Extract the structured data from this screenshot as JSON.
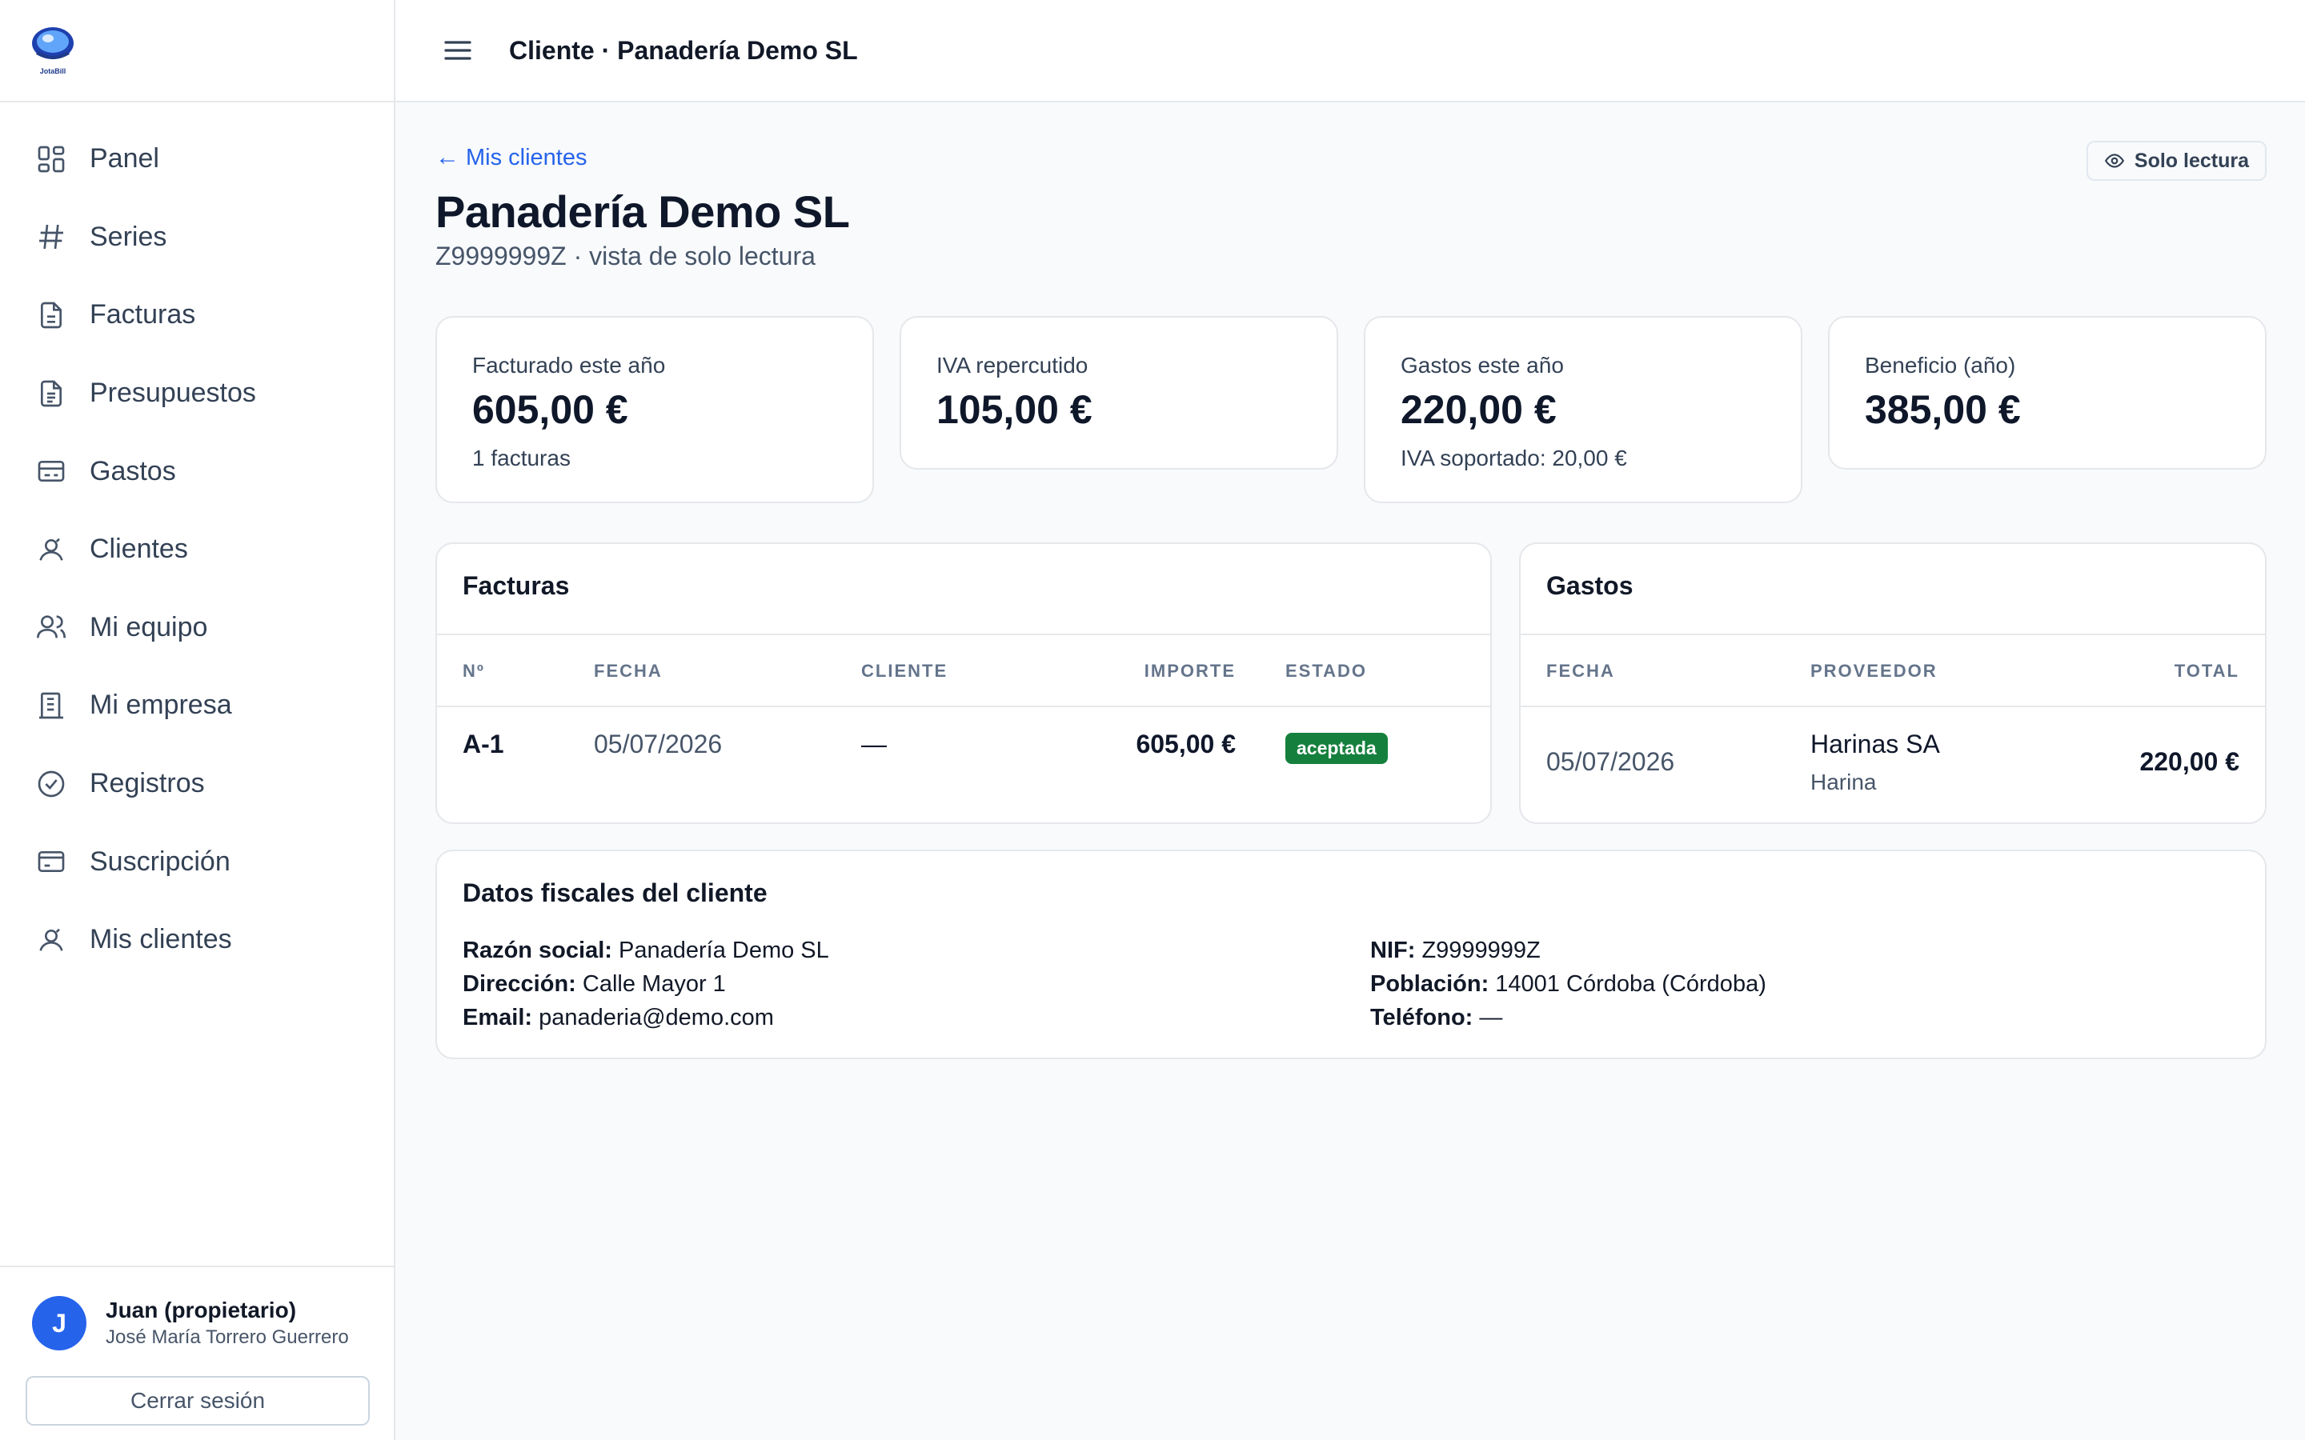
{
  "app": {
    "logo_text": "JotaBill",
    "brand_color": "#2563eb"
  },
  "sidebar": {
    "items": [
      {
        "label": "Panel",
        "icon": "grid-icon"
      },
      {
        "label": "Series",
        "icon": "hash-icon"
      },
      {
        "label": "Facturas",
        "icon": "file-text-icon"
      },
      {
        "label": "Presupuestos",
        "icon": "file-list-icon"
      },
      {
        "label": "Gastos",
        "icon": "receipt-icon"
      },
      {
        "label": "Clientes",
        "icon": "user-circle-icon"
      },
      {
        "label": "Mi equipo",
        "icon": "users-icon"
      },
      {
        "label": "Mi empresa",
        "icon": "building-icon"
      },
      {
        "label": "Registros",
        "icon": "check-circle-icon"
      },
      {
        "label": "Suscripción",
        "icon": "credit-card-icon"
      },
      {
        "label": "Mis clientes",
        "icon": "user-circle-icon"
      }
    ],
    "user": {
      "initial": "J",
      "name": "Juan (propietario)",
      "subtitle": "José María Torrero Guerrero"
    },
    "logout_label": "Cerrar sesión"
  },
  "topbar": {
    "title": "Cliente · Panadería Demo SL"
  },
  "main": {
    "back_link": "Mis clientes",
    "readonly_badge": "Solo lectura",
    "title": "Panadería Demo SL",
    "subtitle": "Z9999999Z · vista de solo lectura",
    "kpis": [
      {
        "label": "Facturado este año",
        "value": "605,00 €",
        "sub": "1 facturas"
      },
      {
        "label": "IVA repercutido",
        "value": "105,00 €",
        "sub": ""
      },
      {
        "label": "Gastos este año",
        "value": "220,00 €",
        "sub": "IVA soportado: 20,00 €"
      },
      {
        "label": "Beneficio (año)",
        "value": "385,00 €",
        "sub": ""
      }
    ],
    "invoices": {
      "title": "Facturas",
      "columns": [
        "Nº",
        "FECHA",
        "CLIENTE",
        "IMPORTE",
        "ESTADO"
      ],
      "rows": [
        {
          "number": "A-1",
          "date": "05/07/2026",
          "client": "—",
          "amount": "605,00 €",
          "status": "aceptada",
          "status_color": "#15803d"
        }
      ]
    },
    "expenses": {
      "title": "Gastos",
      "columns": [
        "FECHA",
        "PROVEEDOR",
        "TOTAL"
      ],
      "rows": [
        {
          "date": "05/07/2026",
          "supplier": "Harinas SA",
          "concept": "Harina",
          "total": "220,00 €"
        }
      ]
    },
    "fiscal": {
      "title": "Datos fiscales del cliente",
      "fields": [
        {
          "label": "Razón social:",
          "value": "Panadería Demo SL"
        },
        {
          "label": "Dirección:",
          "value": "Calle Mayor 1"
        },
        {
          "label": "Email:",
          "value": "panaderia@demo.com"
        },
        {
          "label": "NIF:",
          "value": "Z9999999Z"
        },
        {
          "label": "Población:",
          "value": "14001 Córdoba (Córdoba)"
        },
        {
          "label": "Teléfono:",
          "value": "—"
        }
      ]
    }
  }
}
